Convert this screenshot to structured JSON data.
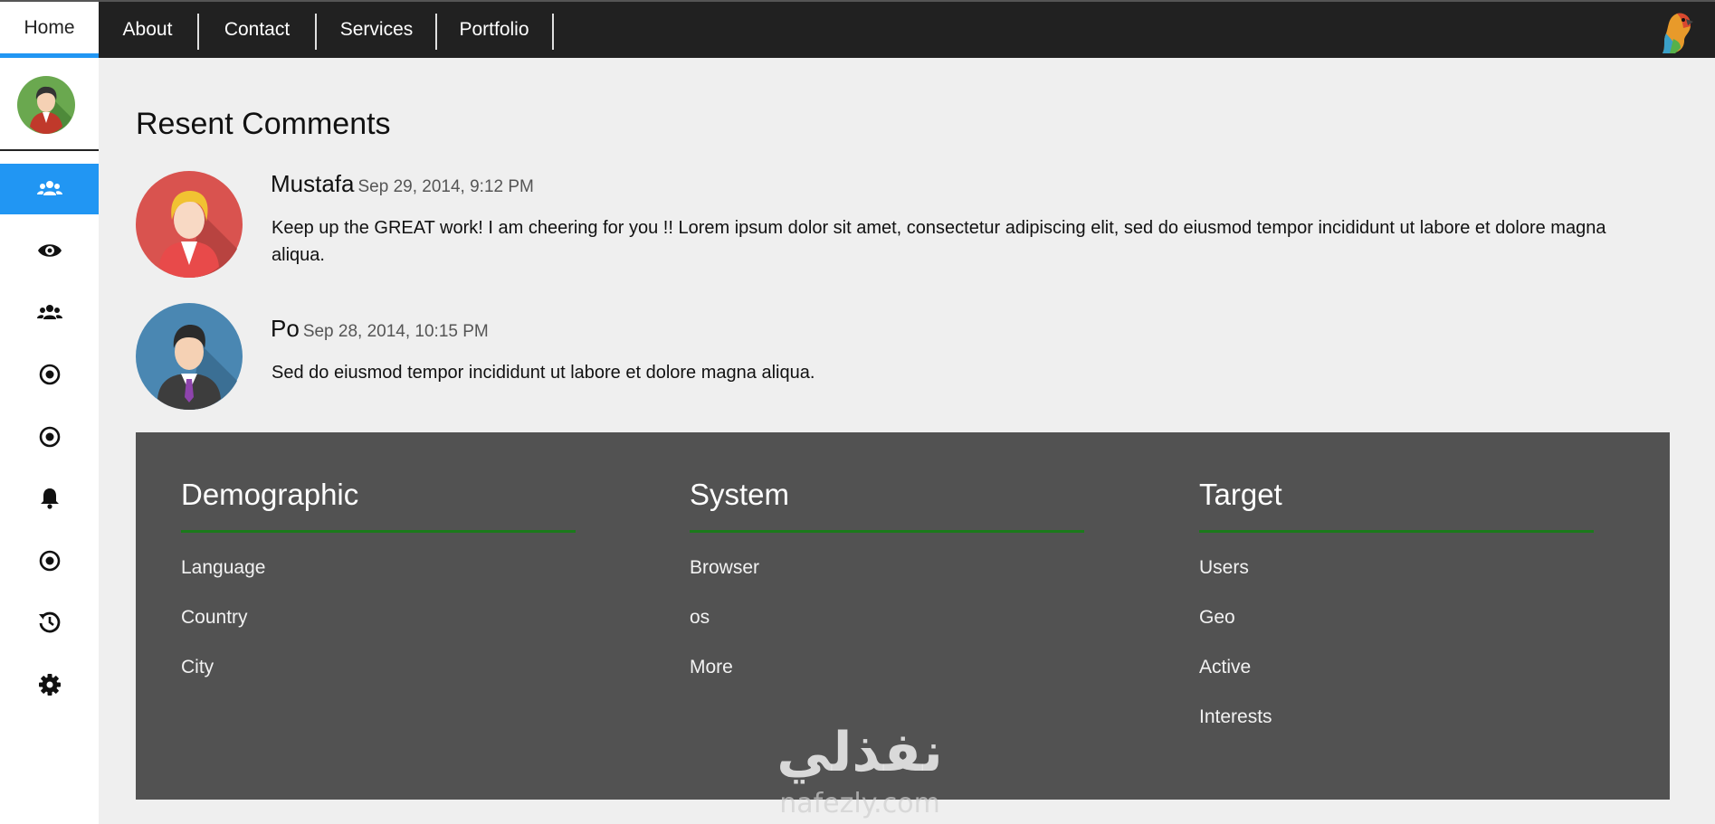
{
  "nav": {
    "tabs": [
      {
        "label": "Home"
      },
      {
        "label": "About"
      },
      {
        "label": "Contact"
      },
      {
        "label": "Services"
      },
      {
        "label": "Portfolio"
      }
    ]
  },
  "sidebar": {
    "items": [
      {
        "icon": "users-icon",
        "active": true
      },
      {
        "icon": "eye-icon"
      },
      {
        "icon": "users-icon"
      },
      {
        "icon": "radio-target-icon"
      },
      {
        "icon": "radio-target-icon"
      },
      {
        "icon": "bell-icon"
      },
      {
        "icon": "radio-target-icon"
      },
      {
        "icon": "history-icon"
      },
      {
        "icon": "gear-icon"
      }
    ]
  },
  "comments": {
    "title": "Resent Comments",
    "items": [
      {
        "name": "Mustafa",
        "date": "Sep 29, 2014, 9:12 PM",
        "text": "Keep up the GREAT work! I am cheering for you !! Lorem ipsum dolor sit amet, consectetur adipiscing elit, sed do eiusmod tempor incididunt ut labore et dolore magna aliqua."
      },
      {
        "name": "Po",
        "date": "Sep 28, 2014, 10:15 PM",
        "text": "Sed do eiusmod tempor incididunt ut labore et dolore magna aliqua."
      }
    ]
  },
  "footer": {
    "columns": [
      {
        "title": "Demographic",
        "links": [
          "Language",
          "Country",
          "City"
        ]
      },
      {
        "title": "System",
        "links": [
          "Browser",
          "os",
          "More"
        ]
      },
      {
        "title": "Target",
        "links": [
          "Users",
          "Geo",
          "Active",
          "Interests"
        ]
      }
    ]
  },
  "watermark": {
    "text": "نفذلي",
    "sub": "nafezly.com"
  },
  "colors": {
    "accent": "#2196f3",
    "topbar": "#212121",
    "panel": "#525252",
    "rule": "#1b7a1b"
  }
}
